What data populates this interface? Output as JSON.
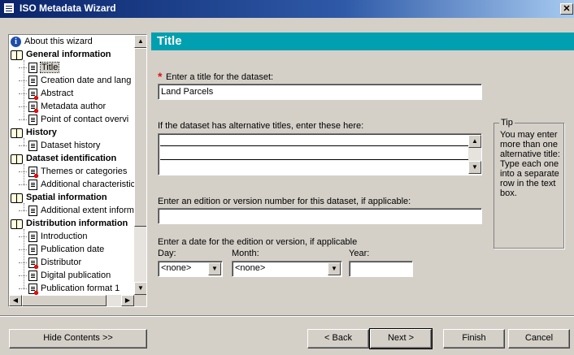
{
  "window": {
    "title": "ISO Metadata Wizard",
    "close_glyph": "✕"
  },
  "tree": {
    "items": [
      {
        "label": "About this wizard",
        "icon": "info-icon",
        "bold": false,
        "level": 0
      },
      {
        "label": "General information",
        "icon": "book-icon",
        "bold": true,
        "level": 0
      },
      {
        "label": "Title",
        "icon": "page-icon",
        "bold": false,
        "level": 1,
        "selected": true
      },
      {
        "label": "Creation date and lang",
        "icon": "page-icon",
        "bold": false,
        "level": 1
      },
      {
        "label": "Abstract",
        "icon": "required-page-icon",
        "bold": false,
        "level": 1
      },
      {
        "label": "Metadata author",
        "icon": "required-page-icon",
        "bold": false,
        "level": 1
      },
      {
        "label": "Point of contact overvi",
        "icon": "page-icon",
        "bold": false,
        "level": 1
      },
      {
        "label": "History",
        "icon": "book-icon",
        "bold": true,
        "level": 0
      },
      {
        "label": "Dataset history",
        "icon": "page-icon",
        "bold": false,
        "level": 1
      },
      {
        "label": "Dataset identification",
        "icon": "book-icon",
        "bold": true,
        "level": 0
      },
      {
        "label": "Themes or categories",
        "icon": "required-page-icon",
        "bold": false,
        "level": 1
      },
      {
        "label": "Additional characteristic",
        "icon": "page-icon",
        "bold": false,
        "level": 1
      },
      {
        "label": "Spatial information",
        "icon": "book-icon",
        "bold": true,
        "level": 0
      },
      {
        "label": "Additional extent inform",
        "icon": "page-icon",
        "bold": false,
        "level": 1
      },
      {
        "label": "Distribution information",
        "icon": "book-icon",
        "bold": true,
        "level": 0
      },
      {
        "label": "Introduction",
        "icon": "page-icon",
        "bold": false,
        "level": 1
      },
      {
        "label": "Publication date",
        "icon": "page-icon",
        "bold": false,
        "level": 1
      },
      {
        "label": "Distributor",
        "icon": "required-page-icon",
        "bold": false,
        "level": 1
      },
      {
        "label": "Digital publication",
        "icon": "page-icon",
        "bold": false,
        "level": 1
      },
      {
        "label": "Publication format 1",
        "icon": "required-page-icon",
        "bold": false,
        "level": 1
      }
    ]
  },
  "page": {
    "header": "Title",
    "required_marker": "*",
    "title_label": "Enter a title for the dataset:",
    "title_value": "Land Parcels",
    "alt_titles_label": "If the dataset has alternative titles, enter these here:",
    "edition_label": "Enter an edition or version number for this dataset, if applicable:",
    "edition_value": "",
    "date_label": "Enter a date for the edition or version, if applicable",
    "day_label": "Day:",
    "day_value": "<none>",
    "month_label": "Month:",
    "month_value": "<none>",
    "year_label": "Year:",
    "year_value": ""
  },
  "tip": {
    "legend": "Tip",
    "text": "You may enter more than one alternative title: Type each one into a separate row in the text box."
  },
  "buttons": {
    "hide_contents": "Hide Contents >>",
    "back": "< Back",
    "next": "Next >",
    "finish": "Finish",
    "cancel": "Cancel"
  },
  "colors": {
    "header_band": "#00a0b0",
    "required": "#e01010",
    "titlebar": "#0a246a"
  }
}
